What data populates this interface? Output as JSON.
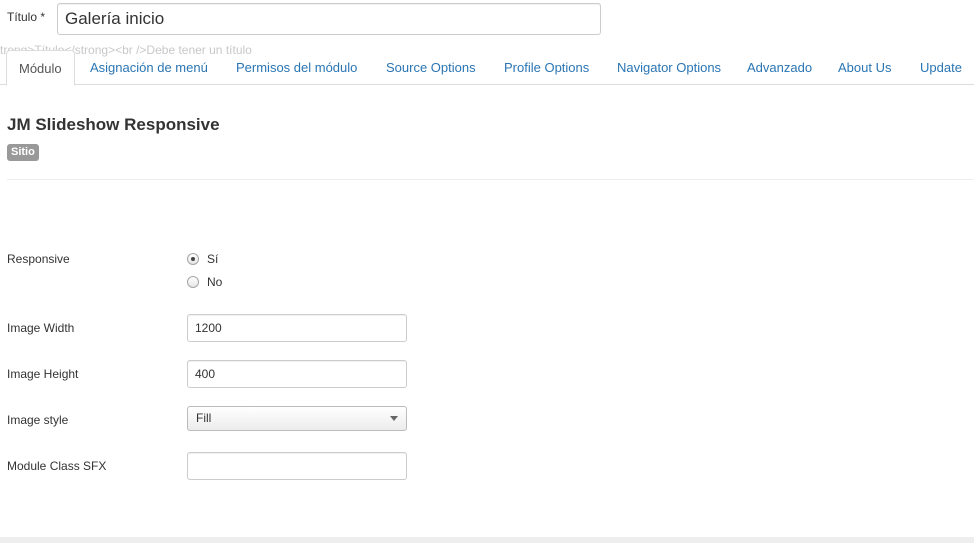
{
  "title_field": {
    "label": "Título *",
    "value": "Galería inicio"
  },
  "tooltip_text": "strong>Título</strong><br />Debe tener un título",
  "tabs": [
    {
      "label": "Módulo",
      "active": true
    },
    {
      "label": "Asignación de menú",
      "active": false
    },
    {
      "label": "Permisos del módulo",
      "active": false
    },
    {
      "label": "Source Options",
      "active": false
    },
    {
      "label": "Profile Options",
      "active": false
    },
    {
      "label": "Navigator Options",
      "active": false
    },
    {
      "label": "Advanzado",
      "active": false
    },
    {
      "label": "About Us",
      "active": false
    },
    {
      "label": "Update",
      "active": false
    }
  ],
  "module": {
    "title": "JM Slideshow Responsive",
    "badge": "Sitio"
  },
  "form": {
    "responsive": {
      "label": "Responsive",
      "options": [
        {
          "label": "Sí",
          "checked": true
        },
        {
          "label": "No",
          "checked": false
        }
      ]
    },
    "image_width": {
      "label": "Image Width",
      "value": "1200"
    },
    "image_height": {
      "label": "Image Height",
      "value": "400"
    },
    "image_style": {
      "label": "Image style",
      "selected": "Fill"
    },
    "module_class_sfx": {
      "label": "Module Class SFX",
      "value": ""
    }
  },
  "colors": {
    "link": "#2a75b3",
    "badge": "#999999"
  }
}
